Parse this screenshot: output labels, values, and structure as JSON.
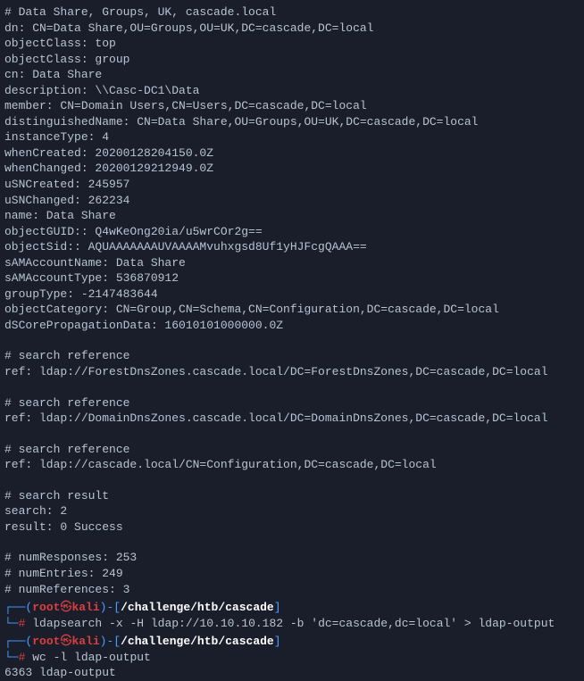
{
  "ldap_output": {
    "header_comment": "# Data Share, Groups, UK, cascade.local",
    "dn": "dn: CN=Data Share,OU=Groups,OU=UK,DC=cascade,DC=local",
    "objectClass1": "objectClass: top",
    "objectClass2": "objectClass: group",
    "cn": "cn: Data Share",
    "description": "description: \\\\Casc-DC1\\Data",
    "member": "member: CN=Domain Users,CN=Users,DC=cascade,DC=local",
    "distinguishedName": "distinguishedName: CN=Data Share,OU=Groups,OU=UK,DC=cascade,DC=local",
    "instanceType": "instanceType: 4",
    "whenCreated": "whenCreated: 20200128204150.0Z",
    "whenChanged": "whenChanged: 20200129212949.0Z",
    "uSNCreated": "uSNCreated: 245957",
    "uSNChanged": "uSNChanged: 262234",
    "name": "name: Data Share",
    "objectGUID": "objectGUID:: Q4wKeOng20ia/u5wrCOr2g==",
    "objectSid": "objectSid:: AQUAAAAAAAUVAAAAMvuhxgsd8Uf1yHJFcgQAAA==",
    "sAMAccountName": "sAMAccountName: Data Share",
    "sAMAccountType": "sAMAccountType: 536870912",
    "groupType": "groupType: -2147483644",
    "objectCategory": "objectCategory: CN=Group,CN=Schema,CN=Configuration,DC=cascade,DC=local",
    "dSCorePropagationData": "dSCorePropagationData: 16010101000000.0Z",
    "search_ref_header": "# search reference",
    "ref1": "ref: ldap://ForestDnsZones.cascade.local/DC=ForestDnsZones,DC=cascade,DC=local",
    "ref2": "ref: ldap://DomainDnsZones.cascade.local/DC=DomainDnsZones,DC=cascade,DC=local",
    "ref3": "ref: ldap://cascade.local/CN=Configuration,DC=cascade,DC=local",
    "search_result_header": "# search result",
    "search": "search: 2",
    "result": "result: 0 Success",
    "numResponses": "# numResponses: 253",
    "numEntries": "# numEntries: 249",
    "numReferences": "# numReferences: 3"
  },
  "prompt": {
    "box_top": "┌──",
    "box_bottom": "└─",
    "paren_open": "(",
    "paren_close": ")",
    "user": "root",
    "at": "㉿",
    "host": "kali",
    "dash": "-",
    "bracket_open": "[",
    "bracket_close": "]",
    "path": "/challenge/htb/cascade",
    "hash": "#"
  },
  "commands": {
    "cmd1": " ldapsearch -x -H ldap://10.10.10.182 -b 'dc=cascade,dc=local' > ldap-output",
    "cmd2": " wc -l ldap-output",
    "cmd2_output": "6363 ldap-output"
  }
}
